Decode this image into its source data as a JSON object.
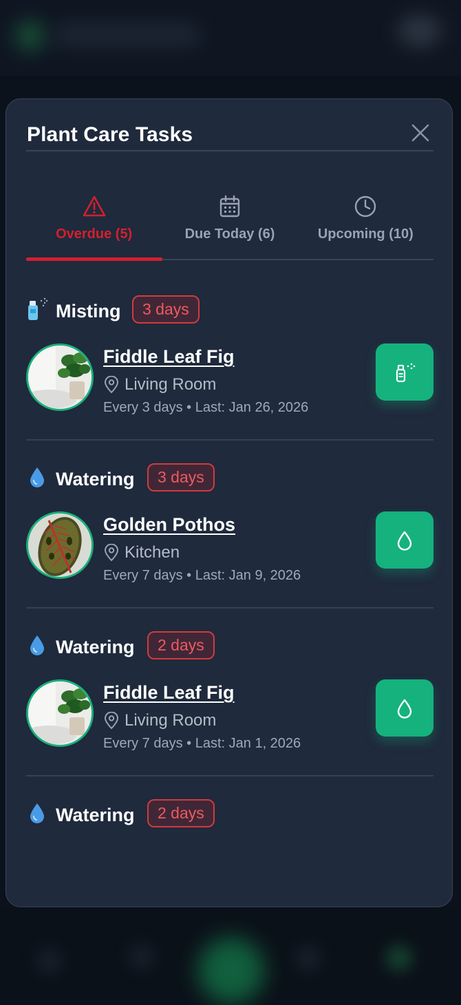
{
  "modal": {
    "title": "Plant Care Tasks",
    "close_icon": "close-icon"
  },
  "tabs": [
    {
      "label": "Overdue (5)",
      "icon": "alert-triangle-icon",
      "active": true
    },
    {
      "label": "Due Today (6)",
      "icon": "calendar-icon",
      "active": false
    },
    {
      "label": "Upcoming (10)",
      "icon": "clock-icon",
      "active": false
    }
  ],
  "tasks": [
    {
      "type": "Misting",
      "type_icon": "spray-bottle-icon",
      "badge": "3 days",
      "plant": "Fiddle Leaf Fig",
      "location": "Living Room",
      "schedule": "Every 3 days • Last: Jan 26, 2026",
      "action_icon": "spray-bottle-icon"
    },
    {
      "type": "Watering",
      "type_icon": "water-drop-icon",
      "badge": "3 days",
      "plant": "Golden Pothos",
      "location": "Kitchen",
      "schedule": "Every 7 days • Last: Jan 9, 2026",
      "action_icon": "water-drop-icon"
    },
    {
      "type": "Watering",
      "type_icon": "water-drop-icon",
      "badge": "2 days",
      "plant": "Fiddle Leaf Fig",
      "location": "Living Room",
      "schedule": "Every 7 days • Last: Jan 1, 2026",
      "action_icon": "water-drop-icon"
    },
    {
      "type": "Watering",
      "type_icon": "water-drop-icon",
      "badge": "2 days"
    }
  ],
  "colors": {
    "accent_green": "#15b27e",
    "overdue_red": "#d3202e",
    "modal_bg": "#1f2a3c"
  }
}
